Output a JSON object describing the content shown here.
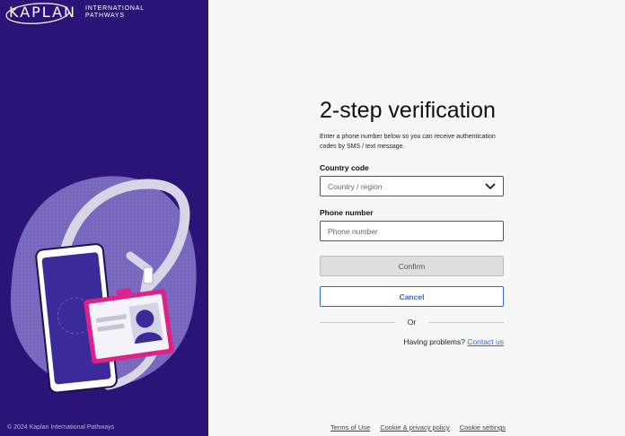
{
  "brand": {
    "logo_word": "KAPLAN",
    "logo_sub_line1": "INTERNATIONAL",
    "logo_sub_line2": "PATHWAYS",
    "copyright": "© 2024 Kaplan International Pathways",
    "left_panel_color": "#2a1478"
  },
  "form": {
    "title": "2-step verification",
    "description": "Enter a phone number below so you can receive authentication codes by SMS / text message.",
    "country_label": "Country code",
    "country_placeholder": "Country / region",
    "phone_label": "Phone number",
    "phone_placeholder": "Phone number",
    "confirm_label": "Confirm",
    "cancel_label": "Cancel",
    "or_label": "Or",
    "problems_text": "Having problems?",
    "contact_link": "Contact us"
  },
  "footer": {
    "terms": "Terms of Use",
    "cookie_privacy": "Cookie & privacy policy",
    "cookie_settings": "Cookie settings"
  },
  "colors": {
    "accent_blue": "#2f6ad0",
    "badge_pink": "#e0218a"
  }
}
